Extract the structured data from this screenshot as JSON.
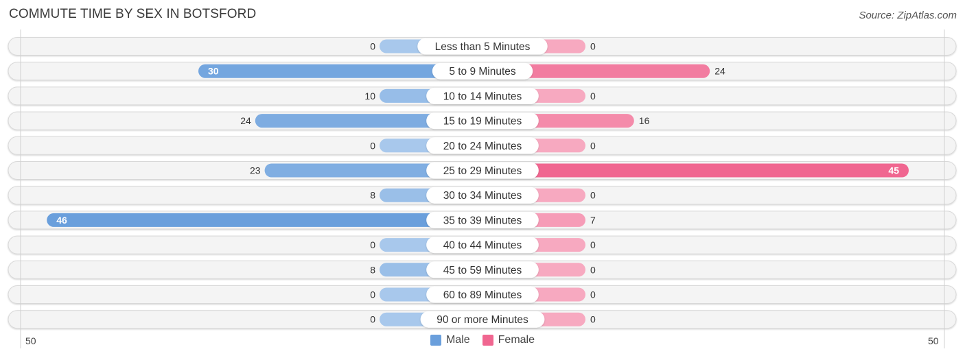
{
  "title": "COMMUTE TIME BY SEX IN BOTSFORD",
  "source": "Source: ZipAtlas.com",
  "colors": {
    "male": "#6a9fdc",
    "male_light": "#a8c8ec",
    "female": "#f06690",
    "female_light": "#f7a9c0",
    "row_bg": "#f4f4f4",
    "row_border": "#d8d8d8"
  },
  "legend": [
    {
      "label": "Male",
      "color": "#6a9fdc"
    },
    {
      "label": "Female",
      "color": "#f06690"
    }
  ],
  "axis": {
    "left_label": "50",
    "right_label": "50"
  },
  "chart_data": {
    "type": "bar",
    "orientation": "horizontal-diverging",
    "title": "COMMUTE TIME BY SEX IN BOTSFORD",
    "categories": [
      "Less than 5 Minutes",
      "5 to 9 Minutes",
      "10 to 14 Minutes",
      "15 to 19 Minutes",
      "20 to 24 Minutes",
      "25 to 29 Minutes",
      "30 to 34 Minutes",
      "35 to 39 Minutes",
      "40 to 44 Minutes",
      "45 to 59 Minutes",
      "60 to 89 Minutes",
      "90 or more Minutes"
    ],
    "series": [
      {
        "name": "Male",
        "values": [
          0,
          30,
          10,
          24,
          0,
          23,
          8,
          46,
          0,
          8,
          0,
          0
        ]
      },
      {
        "name": "Female",
        "values": [
          0,
          24,
          0,
          16,
          0,
          45,
          0,
          7,
          0,
          0,
          0,
          0
        ]
      }
    ],
    "xlim": [
      -50,
      50
    ],
    "xtick_labels": [
      "50",
      "50"
    ],
    "legend_position": "bottom-center",
    "grid": false
  }
}
